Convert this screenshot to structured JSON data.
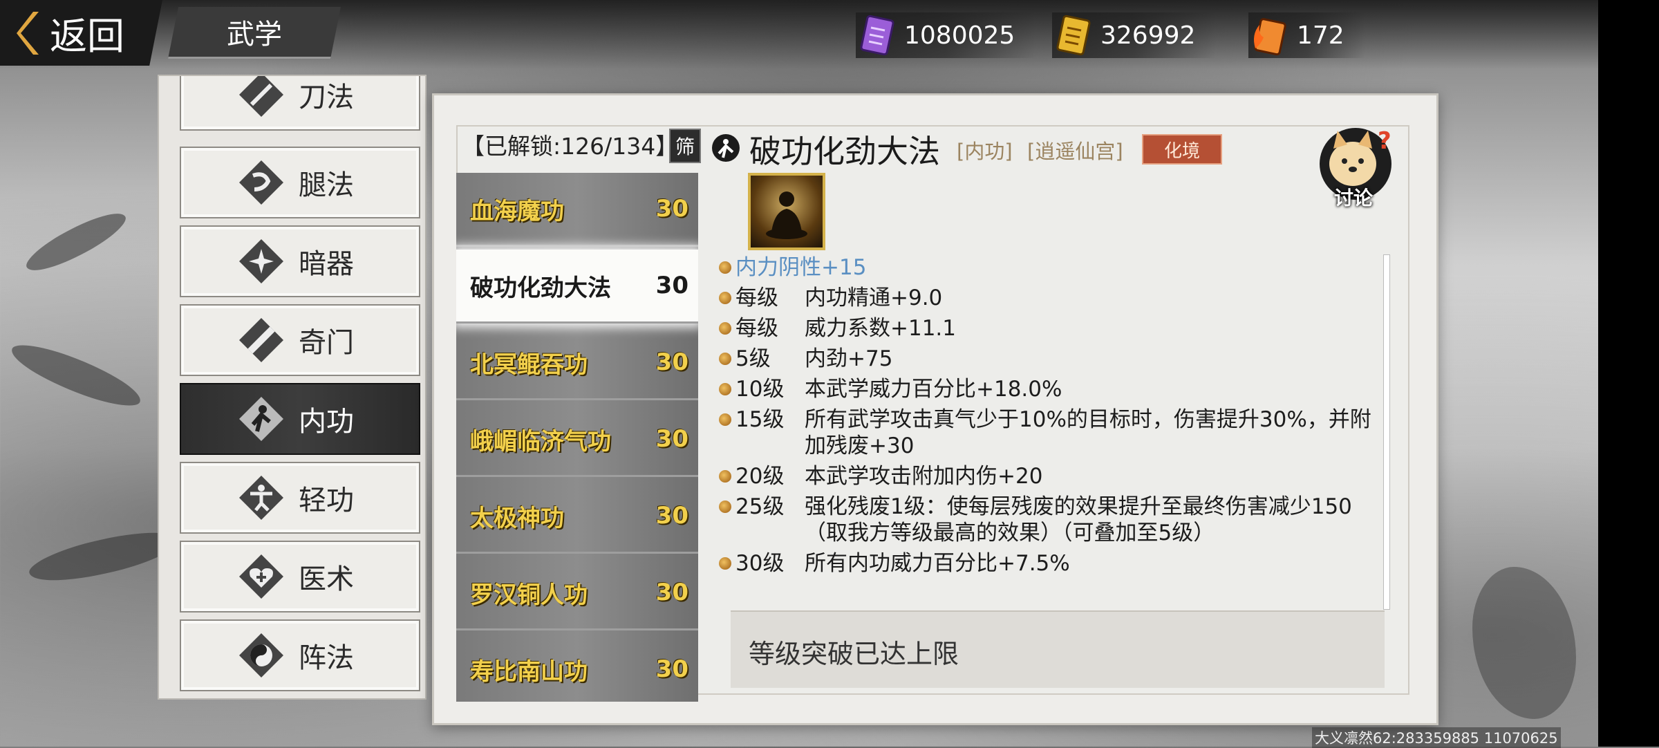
{
  "header": {
    "back_label": "返回",
    "section_title": "武学",
    "currencies": [
      {
        "icon": "purple-scroll-icon",
        "value": "1080025"
      },
      {
        "icon": "gold-scroll-icon",
        "value": "326992"
      },
      {
        "icon": "flame-scroll-icon",
        "value": "172"
      }
    ]
  },
  "categories": [
    {
      "label": "刀法",
      "icon": "blade-icon"
    },
    {
      "label": "腿法",
      "icon": "kick-icon"
    },
    {
      "label": "暗器",
      "icon": "shuriken-icon"
    },
    {
      "label": "奇门",
      "icon": "scroll-weapon-icon"
    },
    {
      "label": "内功",
      "icon": "meditation-icon",
      "active": true
    },
    {
      "label": "轻功",
      "icon": "leap-icon"
    },
    {
      "label": "医术",
      "icon": "heart-cross-icon"
    },
    {
      "label": "阵法",
      "icon": "yin-yang-icon"
    }
  ],
  "list": {
    "unlock_label": "【已解锁:126/134】",
    "filter_label": "筛",
    "skills": [
      {
        "name": "血海魔功",
        "level": "30"
      },
      {
        "name": "破功化劲大法",
        "level": "30",
        "active": true
      },
      {
        "name": "北冥鲲吞功",
        "level": "30"
      },
      {
        "name": "峨嵋临济气功",
        "level": "30"
      },
      {
        "name": "太极神功",
        "level": "30"
      },
      {
        "name": "罗汉铜人功",
        "level": "30"
      },
      {
        "name": "寿比南山功",
        "level": "30"
      }
    ]
  },
  "detail": {
    "title": "破功化劲大法",
    "tag_type": "[内功]",
    "tag_school": "[逍遥仙宫]",
    "realm": "化境",
    "discuss_label": "讨论",
    "effects": [
      {
        "level": "",
        "text": "内力阴性+15",
        "highlight": true
      },
      {
        "level": "每级",
        "text": "内功精通+9.0"
      },
      {
        "level": "每级",
        "text": "威力系数+11.1"
      },
      {
        "level": "5级",
        "text": "内劲+75"
      },
      {
        "level": "10级",
        "text": "本武学威力百分比+18.0%"
      },
      {
        "level": "15级",
        "text": "所有武学攻击真气少于10%的目标时，伤害提升30%，并附加残废+30"
      },
      {
        "level": "20级",
        "text": "本武学攻击附加内伤+20"
      },
      {
        "level": "25级",
        "text": "强化残废1级：使每层残废的效果提升至最终伤害减少150（取我方等级最高的效果）（可叠加至5级）"
      },
      {
        "level": "30级",
        "text": "所有内功威力百分比+7.5%"
      }
    ],
    "limit_text": "等级突破已达上限"
  },
  "footer": {
    "info": "大义凛然62:283359885 11070625"
  },
  "colors": {
    "skill_gold": "#f2d04c",
    "realm_badge": "#b55034",
    "highlight_blue": "#5a8fc2"
  }
}
